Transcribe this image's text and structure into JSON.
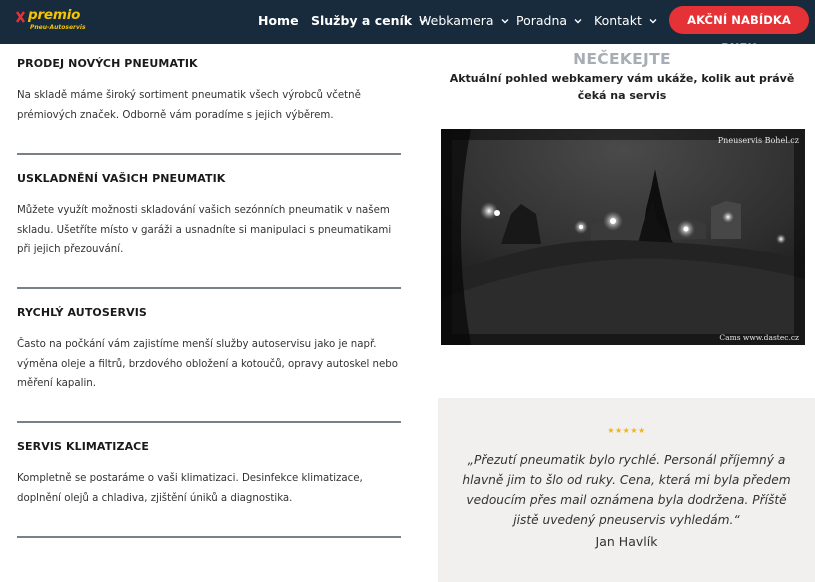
{
  "logo": {
    "name": "premio",
    "sub": "Pneu-Autoservis"
  },
  "nav": {
    "items": [
      {
        "label": "Home",
        "has_dropdown": false
      },
      {
        "label": "Služby a ceník",
        "has_dropdown": true
      },
      {
        "label": "Webkamera",
        "has_dropdown": true
      },
      {
        "label": "Poradna",
        "has_dropdown": true
      },
      {
        "label": "Kontakt",
        "has_dropdown": true
      }
    ],
    "cta_label": "AKČNÍ NABÍDKA PNEU"
  },
  "services": [
    {
      "title": "PRODEJ NOVÝCH PNEUMATIK",
      "text": "Na skladě máme široký sortiment pneumatik všech výrobců včetně prémiových značek. Odborně vám poradíme s jejich výběrem."
    },
    {
      "title": "USKLADNĚNÍ VAŠICH PNEUMATIK",
      "text": "Můžete využít možnosti skladování vašich sezónních pneumatik v našem skladu. Ušetříte místo v garáži a usnadníte si manipulaci s pneumatikami při jejich přezouvání."
    },
    {
      "title": "RYCHLÝ AUTOSERVIS",
      "text": "Často na počkání vám zajistíme menší služby autoservisu jako je např. výměna oleje a filtrů, brzdového obložení a kotoučů, opravy autoskel nebo měření kapalin."
    },
    {
      "title": "SERVIS KLIMATIZACE",
      "text": "Kompletně se postaráme o vaši klimatizaci. Desinfekce klimatizace, doplnění olejů a chladiva, zjištění úniků a diagnostika."
    }
  ],
  "webcam": {
    "heading": "NEČEKEJTE",
    "subheading": "Aktuální pohled webkamery vám ukáže, kolik aut právě čeká na servis",
    "label_top": "Pneuservis Bohel.cz",
    "label_bottom": "Cams www.dastec.cz"
  },
  "review": {
    "stars": "★★★★★",
    "rating": 5,
    "quote": "„Přezutí pneumatik bylo rychlé. Personál příjemný a hlavně jim to šlo od ruky. Cena, která mi byla předem vedoucím přes mail oznámena byla dodržena. Příště jistě uvedený pneuservis vyhledám.“",
    "author": "Jan Havlík"
  },
  "colors": {
    "nav_bg": "#172b3d",
    "cta_bg": "#e53236",
    "logo": "#f5c400",
    "divider": "#7a8088",
    "review_bg": "#f1f0ee",
    "star": "#f2b21b"
  }
}
